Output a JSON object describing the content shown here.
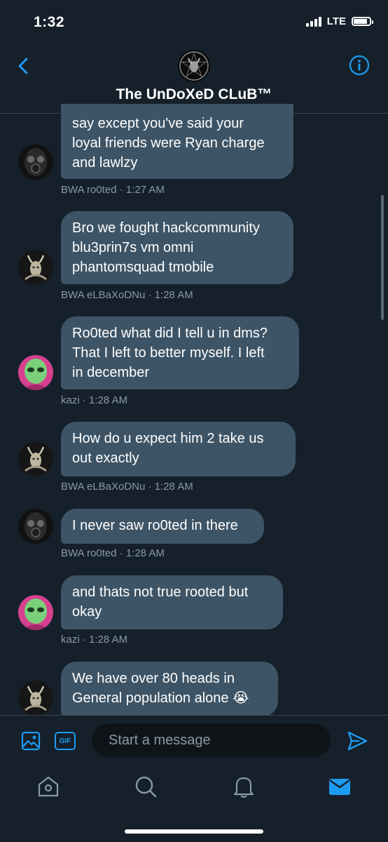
{
  "status_bar": {
    "time": "1:32",
    "network": "LTE"
  },
  "header": {
    "title": "The UnDoXeD CLuB™"
  },
  "messages": [
    {
      "text": "say except you've said your\nloyal friends were Ryan charge\nand lawlzy",
      "author": "BWA ro0ted",
      "time": "1:27 AM",
      "avatar": "gasmask-avatar"
    },
    {
      "text": "Bro we fought hackcommunity\nblu3prin7s vm omni\nphantomsquad tmobile",
      "author": "BWA eLBaXoDNu",
      "time": "1:28 AM",
      "avatar": "baphomet-avatar"
    },
    {
      "text": "Ro0ted what did I tell u in dms?\nThat I left to better myself. I left\nin december",
      "author": "kazi",
      "time": "1:28 AM",
      "avatar": "alien-avatar"
    },
    {
      "text": "How do u expect him 2 take us\nout exactly",
      "author": "BWA eLBaXoDNu",
      "time": "1:28 AM",
      "avatar": "baphomet-avatar"
    },
    {
      "text": "I never saw ro0ted in there",
      "author": "BWA ro0ted",
      "time": "1:28 AM",
      "avatar": "gasmask-avatar"
    },
    {
      "text": "and thats not true rooted but\nokay",
      "author": "kazi",
      "time": "1:28 AM",
      "avatar": "alien-avatar"
    },
    {
      "text": "We have over 80 heads in\nGeneral population alone 😭",
      "author": "",
      "time": "",
      "avatar": "baphomet-avatar"
    }
  ],
  "composer": {
    "placeholder": "Start a message",
    "gif_label": "GIF"
  },
  "colors": {
    "accent": "#1d9bf0",
    "background": "#15202b",
    "bubble": "#3d5466",
    "meta": "#8899a6"
  }
}
